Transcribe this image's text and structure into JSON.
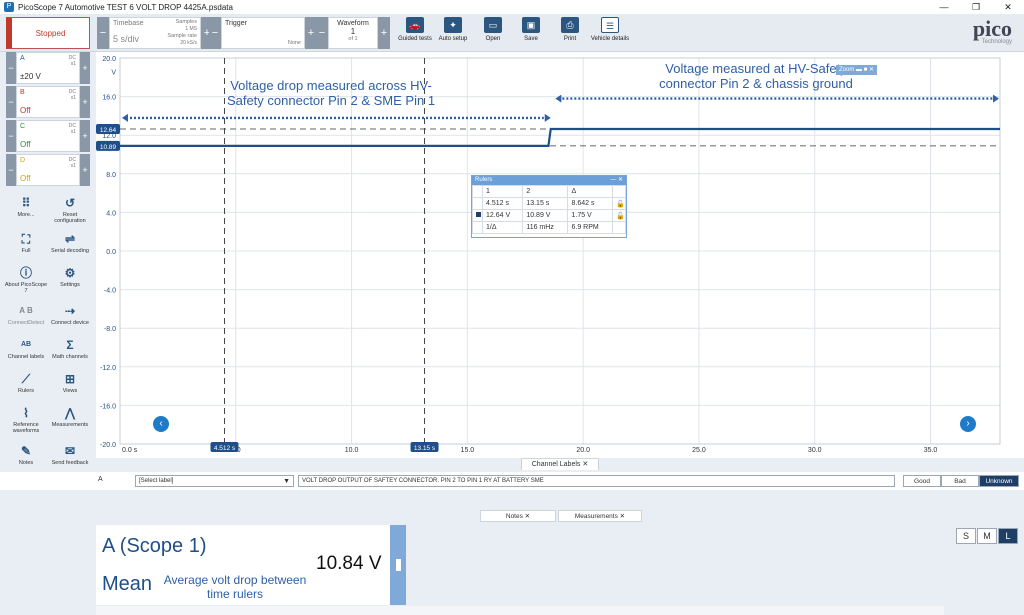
{
  "window": {
    "title": "PicoScope 7 Automotive TEST 6 VOLT DROP 4425A.psdata",
    "controls": [
      "—",
      "❐",
      "✕"
    ]
  },
  "toolbar": {
    "run_state": "Stopped",
    "timebase_label": "Timebase",
    "timebase_value": "5 s/div",
    "samples_label": "Samples",
    "samples_value": "1 MS",
    "sample_rate_label": "Sample rate",
    "sample_rate_value": "20 kS/s",
    "trigger_label": "Trigger",
    "trigger_value": "None",
    "waveform_label": "Waveform",
    "waveform_num": "1",
    "waveform_of": "of 1",
    "tools": [
      "Guided tests",
      "Auto setup",
      "Open",
      "Save",
      "Print",
      "Vehicle details"
    ],
    "logo": "pico",
    "logo_sub": "Technology"
  },
  "channels": [
    {
      "name": "A",
      "coupling": "DC",
      "probe": "x1",
      "range": "±20 V",
      "color": "#1f5fa8"
    },
    {
      "name": "B",
      "coupling": "DC",
      "probe": "x1",
      "range": "Off",
      "color": "#c0392b"
    },
    {
      "name": "C",
      "coupling": "DC",
      "probe": "x1",
      "range": "Off",
      "color": "#2e8b3d"
    },
    {
      "name": "D",
      "coupling": "DC",
      "probe": "x1",
      "range": "Off",
      "color": "#d4a017"
    }
  ],
  "sidebar_tools": [
    {
      "label": "More...",
      "icon": "grid-icon"
    },
    {
      "label": "Reset configuration",
      "icon": "reset-icon"
    },
    {
      "label": "Full",
      "icon": "fullscreen-icon"
    },
    {
      "label": "Serial decoding",
      "icon": "serial-decoding-icon"
    },
    {
      "label": "About PicoScope 7",
      "icon": "info-icon"
    },
    {
      "label": "Settings",
      "icon": "gear-icon"
    },
    {
      "label": "ConnectDetect",
      "icon": "connectdetect-icon"
    },
    {
      "label": "Connect device",
      "icon": "usb-icon"
    },
    {
      "label": "Channel labels",
      "icon": "channel-labels-icon"
    },
    {
      "label": "Math channels",
      "icon": "sigma-icon"
    },
    {
      "label": "Rulers",
      "icon": "ruler-icon"
    },
    {
      "label": "Views",
      "icon": "views-icon"
    },
    {
      "label": "Reference waveforms",
      "icon": "reference-waveform-icon"
    },
    {
      "label": "Measurements",
      "icon": "measurements-icon"
    },
    {
      "label": "Notes",
      "icon": "notes-icon"
    },
    {
      "label": "Send feedback",
      "icon": "feedback-icon"
    }
  ],
  "chart_data": {
    "type": "line",
    "x_unit": "s",
    "y_unit": "V",
    "xlim": [
      0,
      38
    ],
    "ylim": [
      -20,
      20
    ],
    "y_ticks": [
      "20.0",
      "16.0",
      "12.0",
      "8.0",
      "4.0",
      "0.0",
      "-4.0",
      "-8.0",
      "-12.0",
      "-16.0",
      "-20.0"
    ],
    "x_ticks": [
      "0.0 s",
      "5.0",
      "10.0",
      "15.0",
      "20.0",
      "25.0",
      "30.0",
      "35.0"
    ],
    "x_tick_values": [
      0,
      5,
      10,
      15,
      20,
      25,
      30,
      35
    ],
    "series": [
      {
        "color": "#1f4f8a",
        "x": [
          0,
          18.5,
          18.6,
          38
        ],
        "y": [
          10.89,
          10.89,
          12.64,
          12.64
        ]
      }
    ],
    "time_rulers": [
      4.512,
      13.15
    ],
    "time_ruler_labels": [
      "4.512 s",
      "13.15 s"
    ],
    "voltage_rulers": [
      12.64,
      10.89
    ],
    "voltage_ruler_labels": [
      "12.64",
      "10.89"
    ],
    "annotations": [
      "Voltage drop measured across HV- Safety connector Pin 2 & SME Pin 1",
      "Voltage measured at HV-Safety connector Pin 2 & chassis ground"
    ],
    "zoom_label": "Zoom"
  },
  "rulers_box": {
    "title": "Rulers",
    "header": [
      "1",
      "2",
      "Δ"
    ],
    "time_row": [
      "4.512 s",
      "13.15 s",
      "8.642 s"
    ],
    "volt_row": [
      "12.64 V",
      "10.89 V",
      "1.75 V"
    ],
    "freq_row": [
      "1/Δ",
      "116 mHz",
      "6.9 RPM"
    ]
  },
  "channel_labels": {
    "tab": "Channel Labels",
    "channel": "A",
    "select_placeholder": "[Select label]",
    "text": "VOLT DROP OUTPUT OF SAFTEY CONNECTOR. PIN 2 TO PIN 1 RY AT BATTERY SME",
    "buttons": [
      "Good",
      "Bad",
      "Unknown"
    ]
  },
  "bottom_tabs": [
    "Notes",
    "Measurements"
  ],
  "measurement": {
    "title": "A (Scope 1)",
    "stat": "Mean",
    "value": "10.84 V",
    "note": "Average volt drop between time rulers"
  },
  "size_buttons": [
    "S",
    "M",
    "L"
  ],
  "colors": {
    "accent": "#1f5fa8",
    "annotation": "#2e5fa8",
    "stopped": "#c0392b",
    "dark_button": "#1f3f66"
  }
}
